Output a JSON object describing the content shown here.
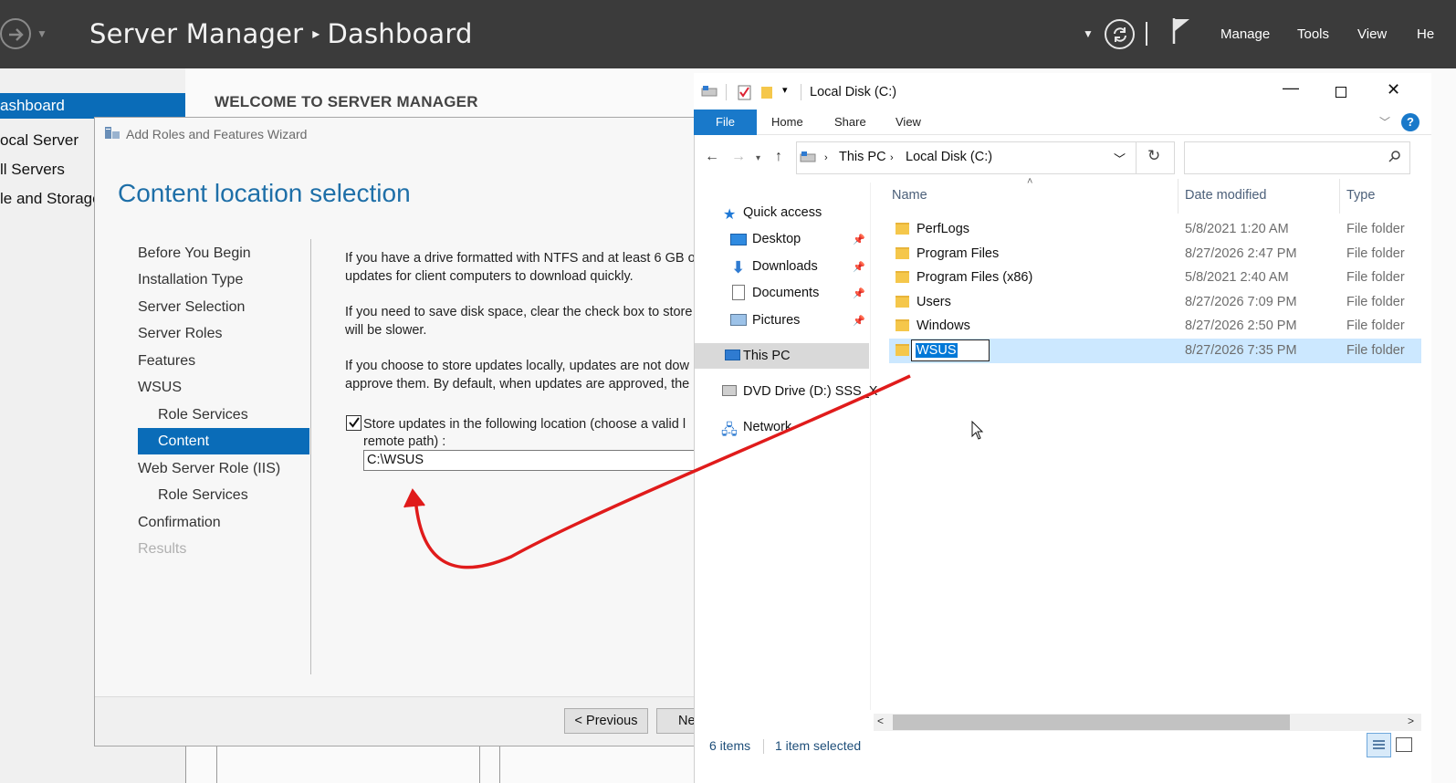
{
  "server_manager": {
    "title": "Server Manager",
    "page": "Dashboard",
    "menu": {
      "manage": "Manage",
      "tools": "Tools",
      "view": "View",
      "help": "He"
    },
    "nav": [
      "ashboard",
      "ocal Server",
      "ll Servers",
      "le and Storage"
    ],
    "welcome": "WELCOME TO SERVER MANAGER"
  },
  "wizard": {
    "window_title": "Add Roles and Features Wizard",
    "heading": "Content location selection",
    "steps": {
      "before": "Before You Begin",
      "install_type": "Installation Type",
      "server_sel": "Server Selection",
      "server_roles": "Server Roles",
      "features": "Features",
      "wsus": "WSUS",
      "role_services": "Role Services",
      "content": "Content",
      "web_server": "Web Server Role (IIS)",
      "role_services2": "Role Services",
      "confirmation": "Confirmation",
      "results": "Results"
    },
    "para1_l1": "If you have a drive formatted with NTFS and at least 6 GB o",
    "para1_l2": "updates for client computers to download quickly.",
    "para2_l1": "If you need to save disk space, clear the check box to store",
    "para2_l2": "will be slower.",
    "para3_l1": "If you choose to store updates locally, updates are not dow",
    "para3_l2": "approve them. By default, when updates are approved, the",
    "checkbox_l1": "Store updates in the following location (choose a valid l",
    "checkbox_l2": "remote path) :",
    "path_value": "C:\\WSUS",
    "btn_previous": "< Previous",
    "btn_next": "Ne"
  },
  "explorer": {
    "title": "Local Disk (C:)",
    "tabs": {
      "file": "File",
      "home": "Home",
      "share": "Share",
      "view": "View"
    },
    "help": "?",
    "address": {
      "this_pc": "This PC",
      "drive": "Local Disk (C:)"
    },
    "search_placeholder": "",
    "nav": {
      "quick_access": "Quick access",
      "desktop": "Desktop",
      "downloads": "Downloads",
      "documents": "Documents",
      "pictures": "Pictures",
      "this_pc": "This PC",
      "dvd": "DVD Drive (D:) SSS_X",
      "network": "Network"
    },
    "columns": {
      "name": "Name",
      "date": "Date modified",
      "type": "Type"
    },
    "rows": [
      {
        "name": "PerfLogs",
        "date": "5/8/2021 1:20 AM",
        "type": "File folder"
      },
      {
        "name": "Program Files",
        "date": "8/27/2026 2:47 PM",
        "type": "File folder"
      },
      {
        "name": "Program Files (x86)",
        "date": "5/8/2021 2:40 AM",
        "type": "File folder"
      },
      {
        "name": "Users",
        "date": "8/27/2026 7:09 PM",
        "type": "File folder"
      },
      {
        "name": "Windows",
        "date": "8/27/2026 2:50 PM",
        "type": "File folder"
      },
      {
        "name": "WSUS",
        "date": "8/27/2026 7:35 PM",
        "type": "File folder"
      }
    ],
    "status": {
      "items": "6 items",
      "selected": "1 item selected"
    }
  },
  "colors": {
    "accent": "#0a6cb8",
    "heading": "#1e6fa8",
    "selection": "#cce8ff",
    "annotation_arrow": "#e01b1b"
  }
}
